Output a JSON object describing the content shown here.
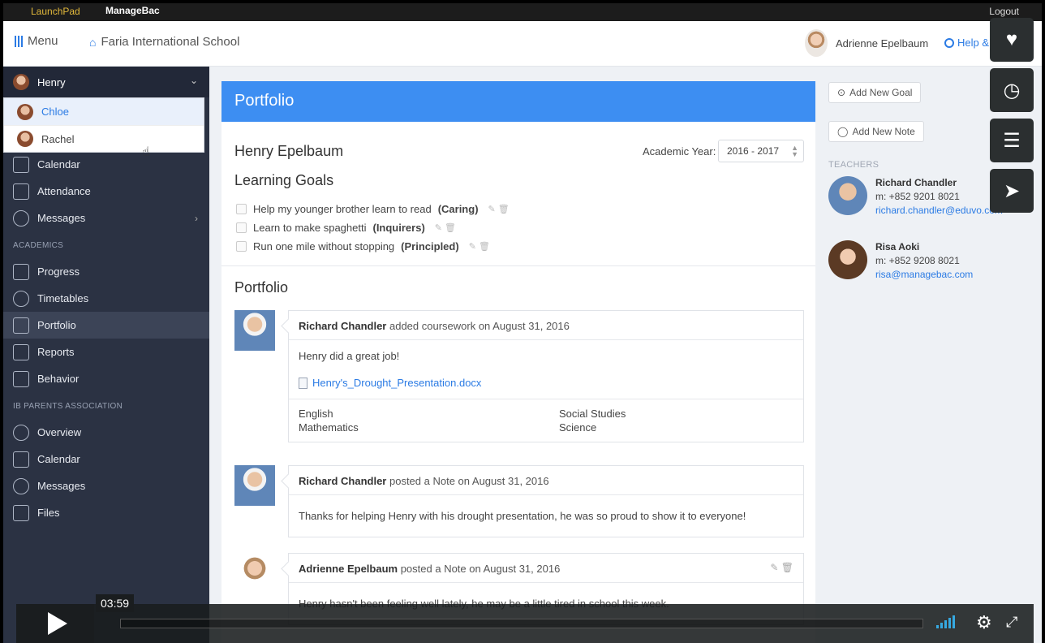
{
  "topbar": {
    "launchpad": "LaunchPad",
    "managebac": "ManageBac",
    "logout": "Logout"
  },
  "header": {
    "menu_label": "Menu",
    "school_name": "Faria International School",
    "user_name": "Adrienne Epelbaum",
    "help_label": "Help & Support"
  },
  "sidebar": {
    "selected_child": "Henry",
    "dropdown_options": [
      "Chloe",
      "Rachel"
    ],
    "items_top": [
      "Calendar",
      "Attendance",
      "Messages"
    ],
    "academics_label": "ACADEMICS",
    "items_academics": [
      "Progress",
      "Timetables",
      "Portfolio",
      "Reports",
      "Behavior"
    ],
    "association_label": "IB PARENTS ASSOCIATION",
    "items_association": [
      "Overview",
      "Calendar",
      "Messages",
      "Files"
    ]
  },
  "main": {
    "header_title": "Portfolio",
    "student_name": "Henry Epelbaum",
    "academic_year_label": "Academic Year:",
    "academic_year_value": "2016 - 2017",
    "learning_goals_title": "Learning Goals",
    "goals": [
      {
        "text": "Help my younger brother learn to read",
        "tag": "(Caring)"
      },
      {
        "text": "Learn to make spaghetti",
        "tag": "(Inquirers)"
      },
      {
        "text": "Run one mile without stopping",
        "tag": "(Principled)"
      }
    ],
    "portfolio_title": "Portfolio",
    "entries": [
      {
        "author": "Richard Chandler",
        "action": "added coursework on August 31, 2016",
        "body": "Henry did a great job!",
        "attachment": "Henry's_Drought_Presentation.docx",
        "subjects": [
          "English",
          "Social Studies",
          "Mathematics",
          "Science"
        ]
      },
      {
        "author": "Richard Chandler",
        "action": "posted a Note on August 31, 2016",
        "body": "Thanks for helping Henry with his drought presentation, he was so proud to show it to everyone!"
      },
      {
        "author": "Adrienne Epelbaum",
        "action": "posted a Note on August 31, 2016",
        "body": "Henry hasn't been feeling well lately, he may be a little tired in school this week."
      }
    ]
  },
  "right": {
    "add_goal": "Add New Goal",
    "add_note": "Add New Note",
    "teachers_label": "TEACHERS",
    "teachers": [
      {
        "name": "Richard Chandler",
        "phone": "m: +852 9201 8021",
        "email": "richard.chandler@eduvo.com"
      },
      {
        "name": "Risa Aoki",
        "phone": "m: +852 9208 8021",
        "email": "risa@managebac.com"
      }
    ]
  },
  "video": {
    "time": "03:59"
  },
  "colors": {
    "accent": "#3d8ef2",
    "sidebar": "#2b3243",
    "link": "#2b7be4"
  }
}
